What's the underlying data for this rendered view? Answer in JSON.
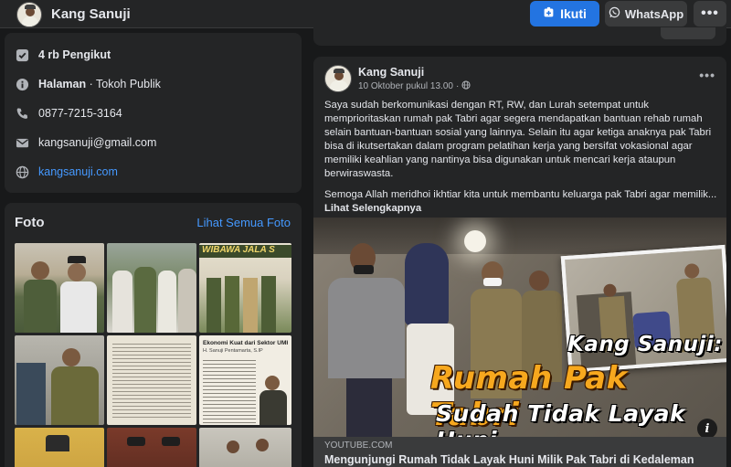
{
  "header": {
    "page_name": "Kang Sanuji",
    "follow_label": "Ikuti",
    "whatsapp_label": "WhatsApp",
    "more_label": "•••"
  },
  "intro": {
    "followers": "4 rb Pengikut",
    "page_label": "Halaman",
    "page_category": "Tokoh Publik",
    "phone": "0877-7215-3164",
    "email": "kangsanuji@gmail.com",
    "website": "kangsanuji.com"
  },
  "photos": {
    "title": "Foto",
    "see_all": "Lihat Semua Foto",
    "banner_text": "WIBAWA JALA S",
    "doc_title": "Ekonomi Kuat dari Sektor UMKM",
    "doc_author": "H. Sanuji Pentamarta, S.IP"
  },
  "post": {
    "author": "Kang Sanuji",
    "time": "10 Oktober pukul 13.00",
    "time_separator": "·",
    "paragraph1": "Saya sudah berkomunikasi dengan RT, RW, dan Lurah setempat untuk memprioritaskan rumah pak Tabri agar segera mendapatkan bantuan rehab rumah selain bantuan-bantuan sosial yang lainnya. Selain itu agar ketiga anaknya pak Tabri bisa di ikutsertakan dalam program pelatihan kerja yang bersifat vokasional agar memiliki keahlian yang nantinya bisa digunakan untuk mencari kerja ataupun berwiraswasta.",
    "paragraph2": "Semoga Allah meridhoi ikhtiar kita untuk membantu keluarga pak Tabri agar memilik...",
    "see_more": "Lihat Selengkapnya",
    "image_headline1": "Kang Sanuji:",
    "image_headline2": "Rumah Pak Tabri",
    "image_headline3": "Sudah Tidak Layak Huni",
    "link_domain": "YOUTUBE.COM",
    "link_title": "Mengunjungi Rumah Tidak Layak Huni Milik Pak Tabri di Kedaleman"
  },
  "colors": {
    "background": "#18191a",
    "card": "#242526",
    "accent": "#2374e1",
    "link": "#4599ff",
    "headline_yellow": "#f7d22e",
    "headline_orange": "#f58a1f"
  },
  "icons": {
    "followers": "check-square-icon",
    "page": "info-icon",
    "phone": "phone-icon",
    "email": "envelope-icon",
    "website": "globe-icon",
    "follow": "follow-icon",
    "whatsapp": "whatsapp-icon",
    "time": "globe-icon"
  }
}
